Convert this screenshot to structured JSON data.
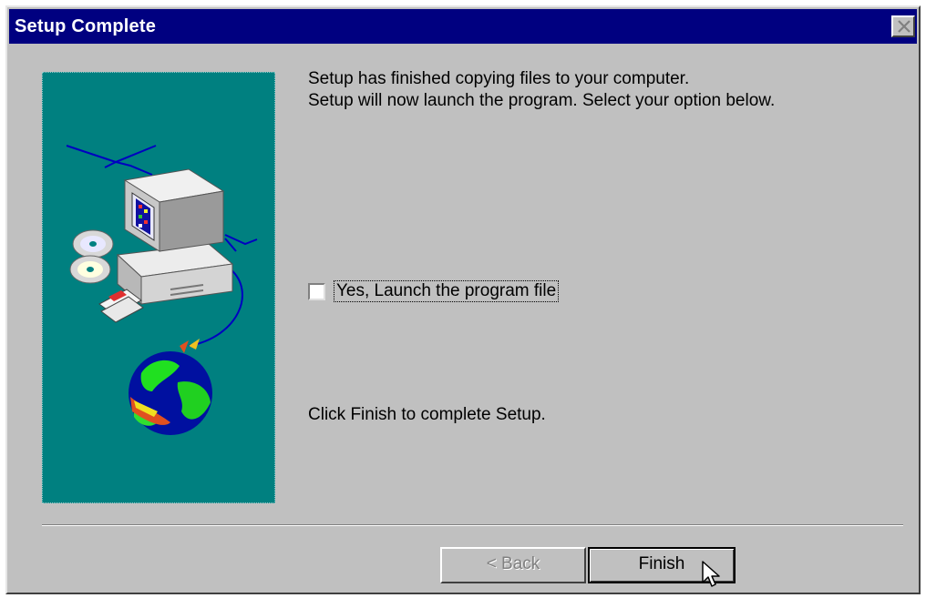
{
  "window": {
    "title": "Setup Complete"
  },
  "message": {
    "line1": "Setup has finished copying files to your computer.",
    "line2": "Setup will now launch the program. Select your option below."
  },
  "launch_option": {
    "label": "Yes, Launch the program file",
    "checked": false
  },
  "finish_hint": "Click Finish to complete Setup.",
  "buttons": {
    "back_label": "< Back",
    "finish_label": "Finish"
  },
  "colors": {
    "titlebar": "#000080",
    "panel_background": "#008080",
    "dialog_background": "#c0c0c0"
  },
  "icons": [
    "close-icon",
    "computer-icon",
    "cd-icon",
    "floppy-disk-icon",
    "globe-icon",
    "mouse-pointer-icon"
  ]
}
